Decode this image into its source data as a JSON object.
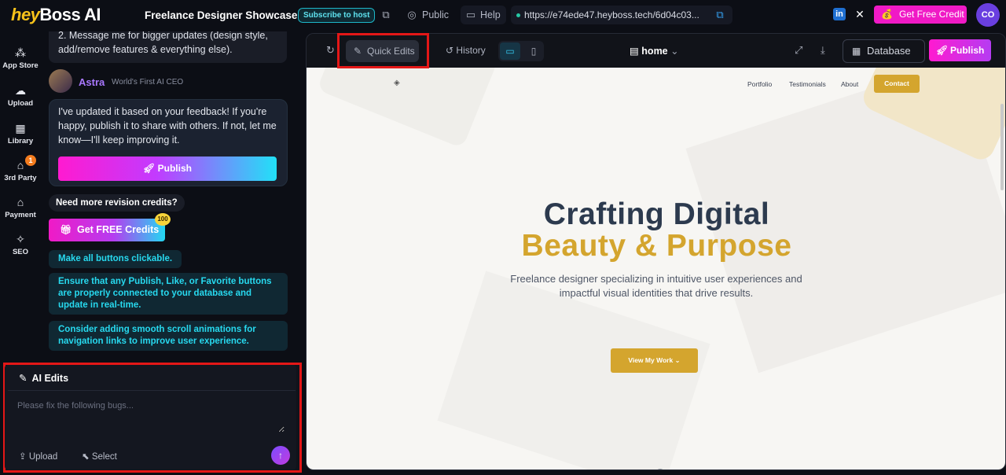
{
  "topbar": {
    "logo_hey": "hey",
    "logo_rest": "Boss AI",
    "project_title": "Freelance Designer Showcase",
    "subscribe_badge": "Subscribe to host",
    "public_label": "Public",
    "help_label": "Help",
    "url": "https://e74ede47.heyboss.tech/6d04c03...",
    "get_credit_label": "Get Free Credit",
    "avatar_initials": "CO"
  },
  "sidebar": {
    "items": [
      {
        "label": "App Store",
        "icon": "apps-icon"
      },
      {
        "label": "Upload",
        "icon": "upload-cloud-icon"
      },
      {
        "label": "Library",
        "icon": "grid-icon"
      },
      {
        "label": "3rd Party",
        "icon": "store-icon",
        "badge": "1"
      },
      {
        "label": "Payment",
        "icon": "shop-icon"
      },
      {
        "label": "SEO",
        "icon": "wand-icon"
      }
    ]
  },
  "chat": {
    "prev_message": "2.  Message me for bigger updates (design style, add/remove features & everything else).",
    "assistant_name": "Astra",
    "assistant_subtitle": "World's First AI CEO",
    "assistant_message": "I've updated it based on your feedback! If you're happy, publish it to share with others. If not, let me know—I'll keep improving it.",
    "publish_label": "Publish",
    "revision_prompt": "Need more revision credits?",
    "free_credits_label": "Get FREE Credits",
    "free_credits_badge": "100",
    "suggestions": [
      "Make all buttons clickable.",
      "Ensure that any Publish, Like, or Favorite buttons are properly connected to your database and update in real-time.",
      "Consider adding smooth scroll animations for navigation links to improve user experience."
    ]
  },
  "ai_edits": {
    "title": "AI Edits",
    "placeholder": "Please fix the following bugs...",
    "upload_label": "Upload",
    "select_label": "Select"
  },
  "preview_toolbar": {
    "quick_edits_label": "Quick Edits",
    "history_label": "History",
    "page_name": "home",
    "database_label": "Database",
    "publish_label": "Publish"
  },
  "site": {
    "nav": [
      "Portfolio",
      "Testimonials",
      "About"
    ],
    "contact_label": "Contact",
    "hero_line1": "Crafting Digital",
    "hero_line2": "Beauty & Purpose",
    "hero_subtitle": "Freelance designer specializing in intuitive user experiences and impactful visual identities that drive results.",
    "hero_button": "View My Work"
  },
  "colors": {
    "accent_magenta": "#f01ac6",
    "accent_cyan": "#21e1f7",
    "gold": "#d4a52e",
    "highlight_red": "#e41717"
  }
}
